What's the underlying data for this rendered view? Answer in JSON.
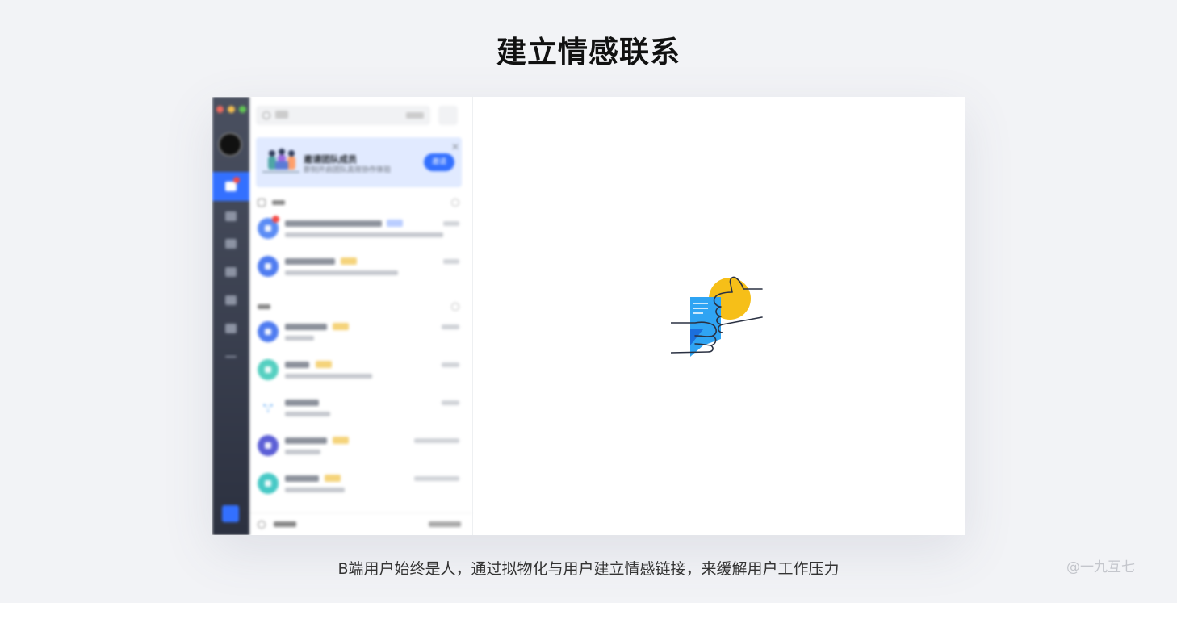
{
  "page": {
    "title": "建立情感联系",
    "caption": "B端用户始终是人，通过拟物化与用户建立情感链接，来缓解用户工作压力",
    "watermark": "@一九互七"
  },
  "app": {
    "window_dots": [
      "#ed6a5e",
      "#f4be4f",
      "#61c454"
    ],
    "accent": "#3370ff",
    "sidebar_icons": [
      "chat-icon",
      "video-icon",
      "calendar-icon",
      "docs-icon",
      "contacts-icon",
      "workplace-icon",
      "more-icon"
    ],
    "invite_banner": {
      "title": "邀请团队成员",
      "subtitle": "即刻开启团队高效协作体验",
      "button": "邀请"
    },
    "empty_state_illustration": "thumbs-up-with-document",
    "chat_rows": [
      {
        "avatar_color": "#5b8cf5",
        "tag_color": "#b9cdff",
        "badge": true
      },
      {
        "avatar_color": "#4f7cf0",
        "tag_color": "#f5d37a",
        "badge": false
      },
      {
        "avatar_color": "#4f7cf0",
        "tag_color": "#f5d37a",
        "badge": false
      },
      {
        "avatar_color": "#55d0c1",
        "tag_color": "#f5d37a",
        "badge": false
      },
      {
        "avatar_color": "#ffffff",
        "tag_color": null,
        "badge": false
      },
      {
        "avatar_color": "#5c5fd6",
        "tag_color": "#f5d37a",
        "badge": false
      },
      {
        "avatar_color": "#48c9c6",
        "tag_color": "#f5d37a",
        "badge": false
      }
    ]
  }
}
